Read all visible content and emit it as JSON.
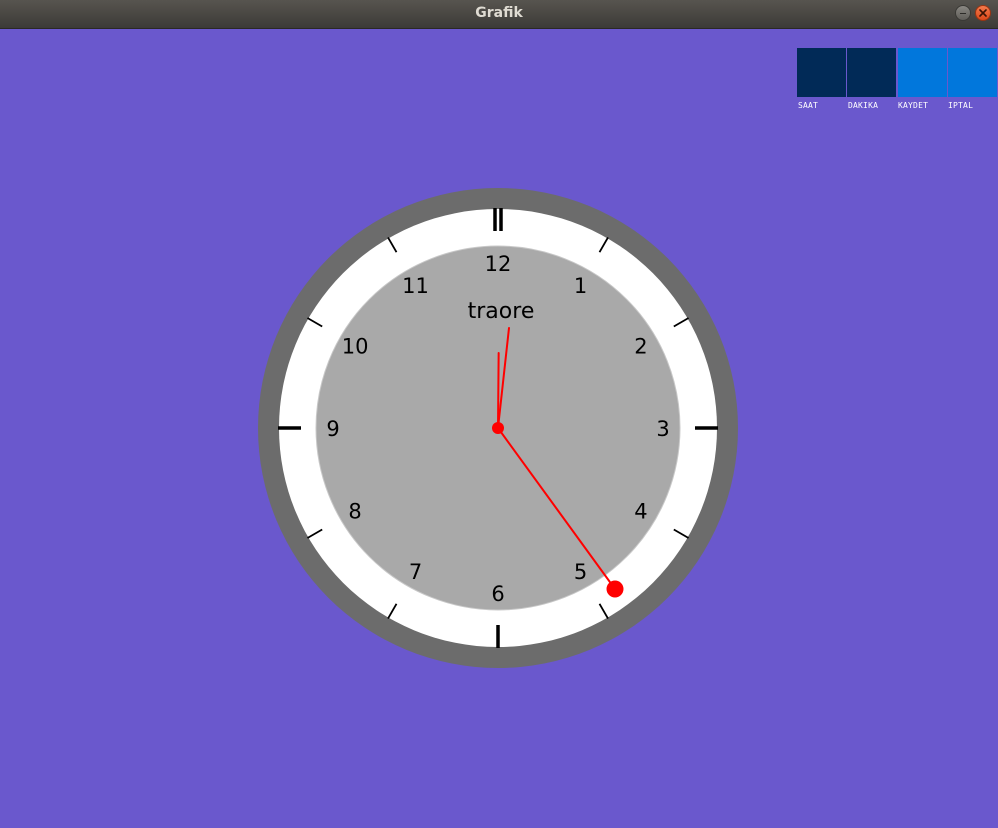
{
  "window": {
    "title": "Grafik"
  },
  "toolbar": [
    {
      "label": "SAAT",
      "color": "#012a57"
    },
    {
      "label": "DAKIKA",
      "color": "#012a57"
    },
    {
      "label": "KAYDET",
      "color": "#0177dc"
    },
    {
      "label": "IPTAL",
      "color": "#0177dc"
    }
  ],
  "clock": {
    "brand": "traore",
    "numbers": [
      "12",
      "1",
      "2",
      "3",
      "4",
      "5",
      "6",
      "7",
      "8",
      "9",
      "10",
      "11"
    ],
    "time": {
      "hour": 12,
      "minute": 25
    },
    "colors": {
      "background": "#6a58cd",
      "bezel": "#6c6c6c",
      "ring": "#ffffff",
      "dial": "#a9a9a9",
      "hands": "#ff0000",
      "ticks": "#000000",
      "marker": "#ff0000"
    }
  }
}
